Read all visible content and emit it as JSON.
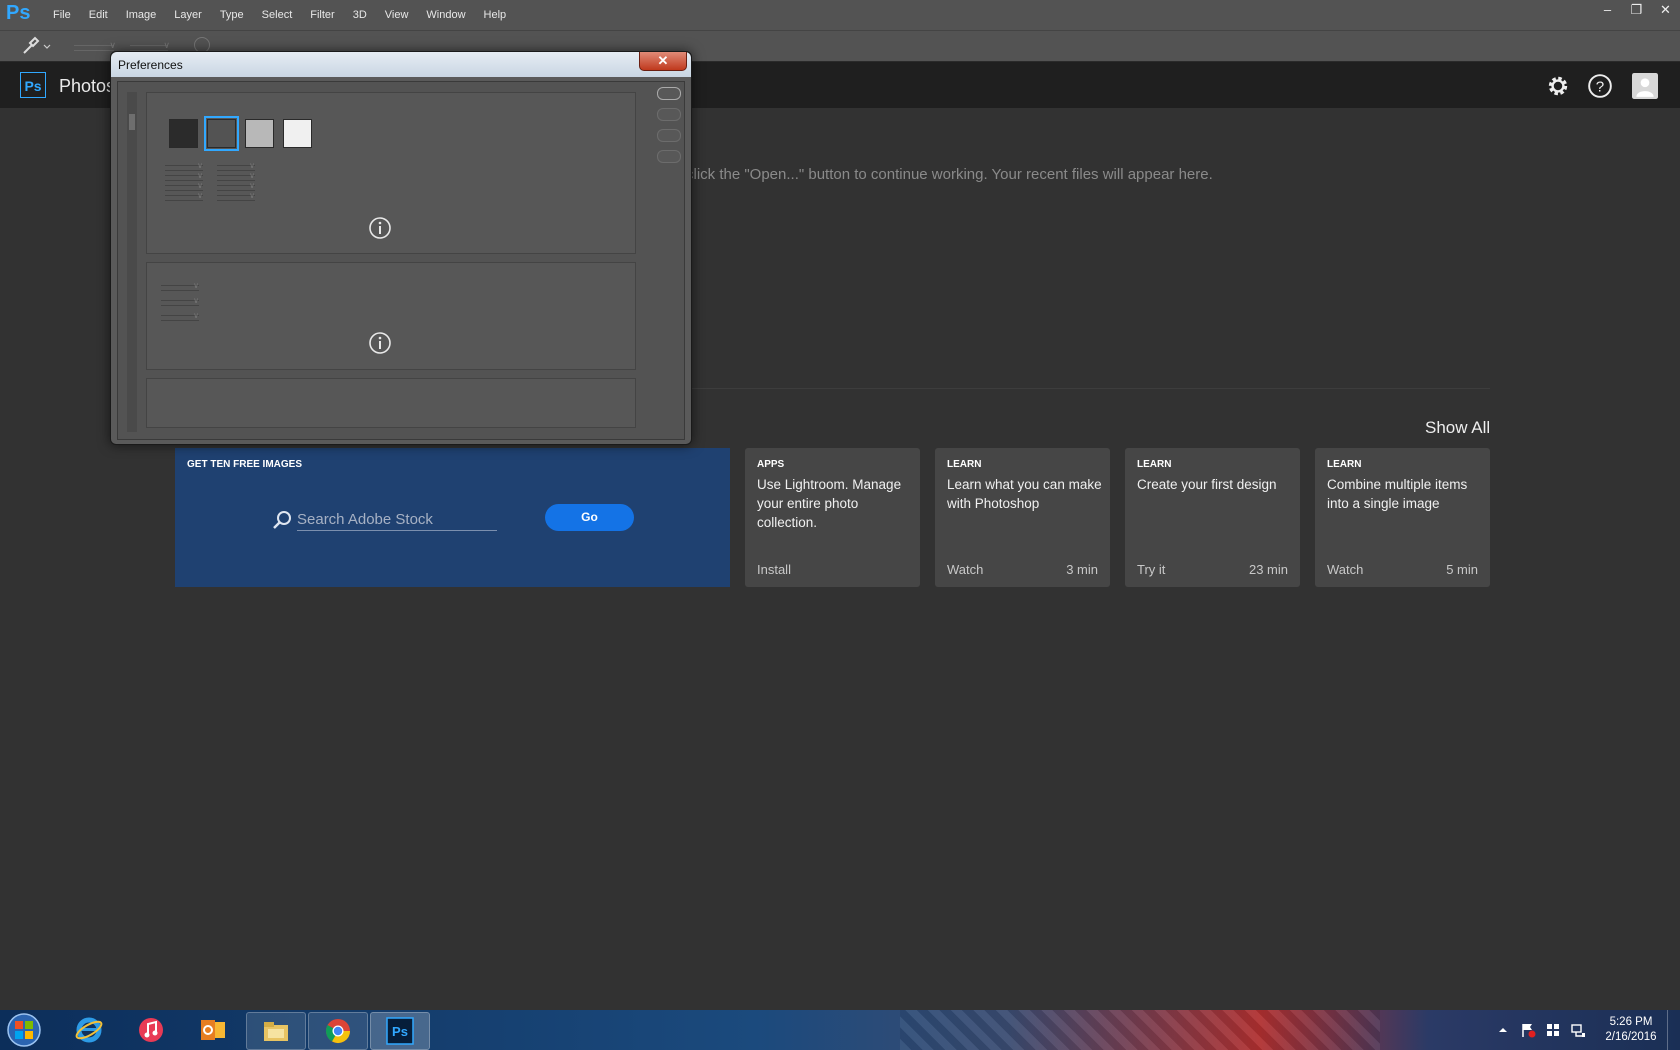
{
  "menubar": {
    "app_mark": "Ps",
    "menus": [
      "File",
      "Edit",
      "Image",
      "Layer",
      "Type",
      "Select",
      "Filter",
      "3D",
      "View",
      "Window",
      "Help"
    ],
    "window_controls": [
      "minimize-icon",
      "restore-icon",
      "close-icon"
    ]
  },
  "options_bar": {
    "tool_icon": "eyedropper-icon"
  },
  "header": {
    "logo": "Ps",
    "app_name": "Photos",
    "icons": [
      "gear-icon",
      "help-icon",
      "user-icon"
    ]
  },
  "main": {
    "recent_message": "click the \"Open...\" button to continue working. Your recent files will appear here.",
    "show_all": "Show All",
    "stock": {
      "title": "GET TEN FREE IMAGES",
      "search_placeholder": "Search Adobe Stock",
      "go": "Go",
      "color": "#1f4171"
    },
    "cards": [
      {
        "category": "APPS",
        "title": "Use Lightroom. Manage your entire photo collection.",
        "action": "Install",
        "duration": ""
      },
      {
        "category": "LEARN",
        "title": "Learn what you can make with Photoshop",
        "action": "Watch",
        "duration": "3 min"
      },
      {
        "category": "LEARN",
        "title": "Create your first design",
        "action": "Try it",
        "duration": "23 min"
      },
      {
        "category": "LEARN",
        "title": "Combine multiple items into a single image",
        "action": "Watch",
        "duration": "5 min"
      }
    ]
  },
  "dialog": {
    "title": "Preferences",
    "close": "✕",
    "color_themes": [
      "#2b2b2b",
      "#535353",
      "#b8b8b8",
      "#f0f0f0"
    ],
    "selected_theme_color": "#31a8ff"
  },
  "taskbar": {
    "apps": [
      "internet-explorer-icon",
      "itunes-icon",
      "outlook-icon",
      "file-explorer-icon",
      "chrome-icon",
      "photoshop-icon"
    ],
    "time": "5:26 PM",
    "date": "2/16/2016"
  }
}
